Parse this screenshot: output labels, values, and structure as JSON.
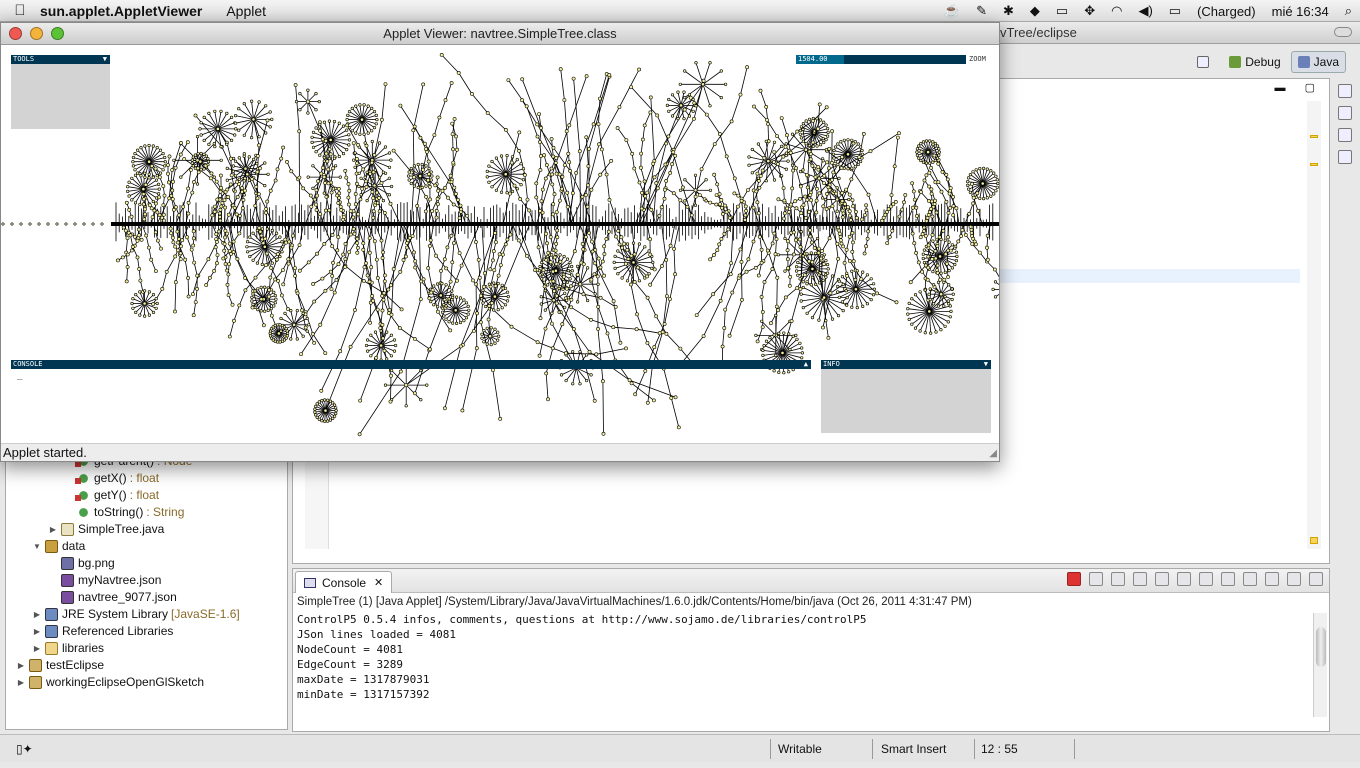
{
  "menubar": {
    "app_name": "sun.applet.AppletViewer",
    "menus": [
      "Applet"
    ],
    "battery_status": "(Charged)",
    "clock": "mié 16:34"
  },
  "eclipse": {
    "window_title": "vTree/eclipse",
    "perspectives": [
      {
        "label": "Debug",
        "active": false
      },
      {
        "label": "Java",
        "active": true
      }
    ]
  },
  "explorer": {
    "rows": [
      {
        "indent": 3,
        "twisty": "",
        "icon": "method",
        "label": "getParent()",
        "ret": ": Node"
      },
      {
        "indent": 3,
        "twisty": "",
        "icon": "method",
        "label": "getX()",
        "ret": ": float"
      },
      {
        "indent": 3,
        "twisty": "",
        "icon": "method",
        "label": "getY()",
        "ret": ": float"
      },
      {
        "indent": 3,
        "twisty": "",
        "icon": "methodpub",
        "label": "toString()",
        "ret": ": String"
      },
      {
        "indent": 2,
        "twisty": "▶",
        "icon": "jfile",
        "label": "SimpleTree.java",
        "ret": ""
      },
      {
        "indent": 1,
        "twisty": "▼",
        "icon": "pkg",
        "label": "data",
        "ret": ""
      },
      {
        "indent": 2,
        "twisty": "",
        "icon": "img",
        "label": "bg.png",
        "ret": ""
      },
      {
        "indent": 2,
        "twisty": "",
        "icon": "json",
        "label": "myNavtree.json",
        "ret": ""
      },
      {
        "indent": 2,
        "twisty": "",
        "icon": "json",
        "label": "navtree_9077.json",
        "ret": ""
      },
      {
        "indent": 1,
        "twisty": "▶",
        "icon": "lib",
        "label": "JRE System Library",
        "ret": "[JavaSE-1.6]"
      },
      {
        "indent": 1,
        "twisty": "▶",
        "icon": "lib",
        "label": "Referenced Libraries",
        "ret": ""
      },
      {
        "indent": 1,
        "twisty": "▶",
        "icon": "folder",
        "label": "libraries",
        "ret": ""
      },
      {
        "indent": 0,
        "twisty": "▶",
        "icon": "proj",
        "label": "testEclipse",
        "ret": ""
      },
      {
        "indent": 0,
        "twisty": "▶",
        "icon": "proj",
        "label": "workingEclipseOpenGlSketch",
        "ret": ""
      }
    ]
  },
  "console": {
    "tab_label": "Console",
    "header": "SimpleTree (1) [Java Applet] /System/Library/Java/JavaVirtualMachines/1.6.0.jdk/Contents/Home/bin/java (Oct 26, 2011 4:31:47 PM)",
    "lines": [
      "ControlP5 0.5.4 infos, comments, questions at http://www.sojamo.de/libraries/controlP5",
      "JSon lines loaded = 4081",
      "NodeCount = 4081",
      "EdgeCount = 3289",
      "maxDate = 1317879031",
      "minDate = 1317157392"
    ]
  },
  "statusbar": {
    "writable": "Writable",
    "insert_mode": "Smart Insert",
    "position": "12 : 55"
  },
  "applet": {
    "title": "Applet Viewer: navtree.SimpleTree.class",
    "status": "Applet started.",
    "tools_label": "TOOLS",
    "console_label": "CONSOLE",
    "console_text": "_",
    "info_label": "INFO",
    "zoom_value": "1504.00",
    "zoom_fraction": 0.28,
    "zoom_label": "ZOOM"
  },
  "colors": {
    "p5_bar": "#003652",
    "p5_fill": "#00698c",
    "p5_panel": "#d3d3d3",
    "node_fill": "#f5f0a0"
  }
}
